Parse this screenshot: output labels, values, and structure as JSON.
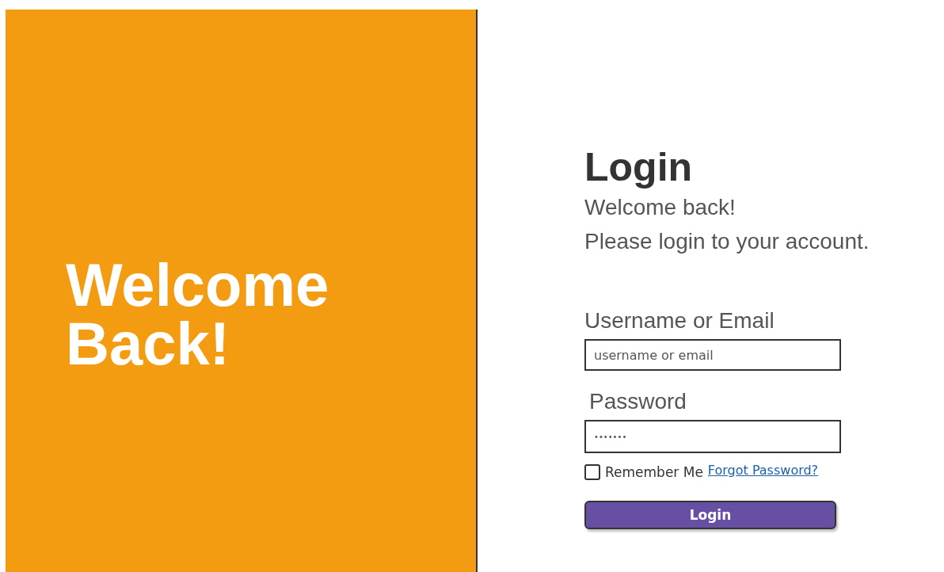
{
  "hero": {
    "title": "Welcome Back!"
  },
  "login": {
    "title": "Login",
    "subtitle_lines": [
      "Welcome back!",
      "Please login to your account."
    ],
    "username": {
      "label": "Username or Email",
      "placeholder": "username or email"
    },
    "password": {
      "label": "Password",
      "value": "•••••••"
    },
    "remember": {
      "label": "Remember Me",
      "checked": false
    },
    "forgot_link": "Forgot Password?",
    "submit": "Login"
  }
}
